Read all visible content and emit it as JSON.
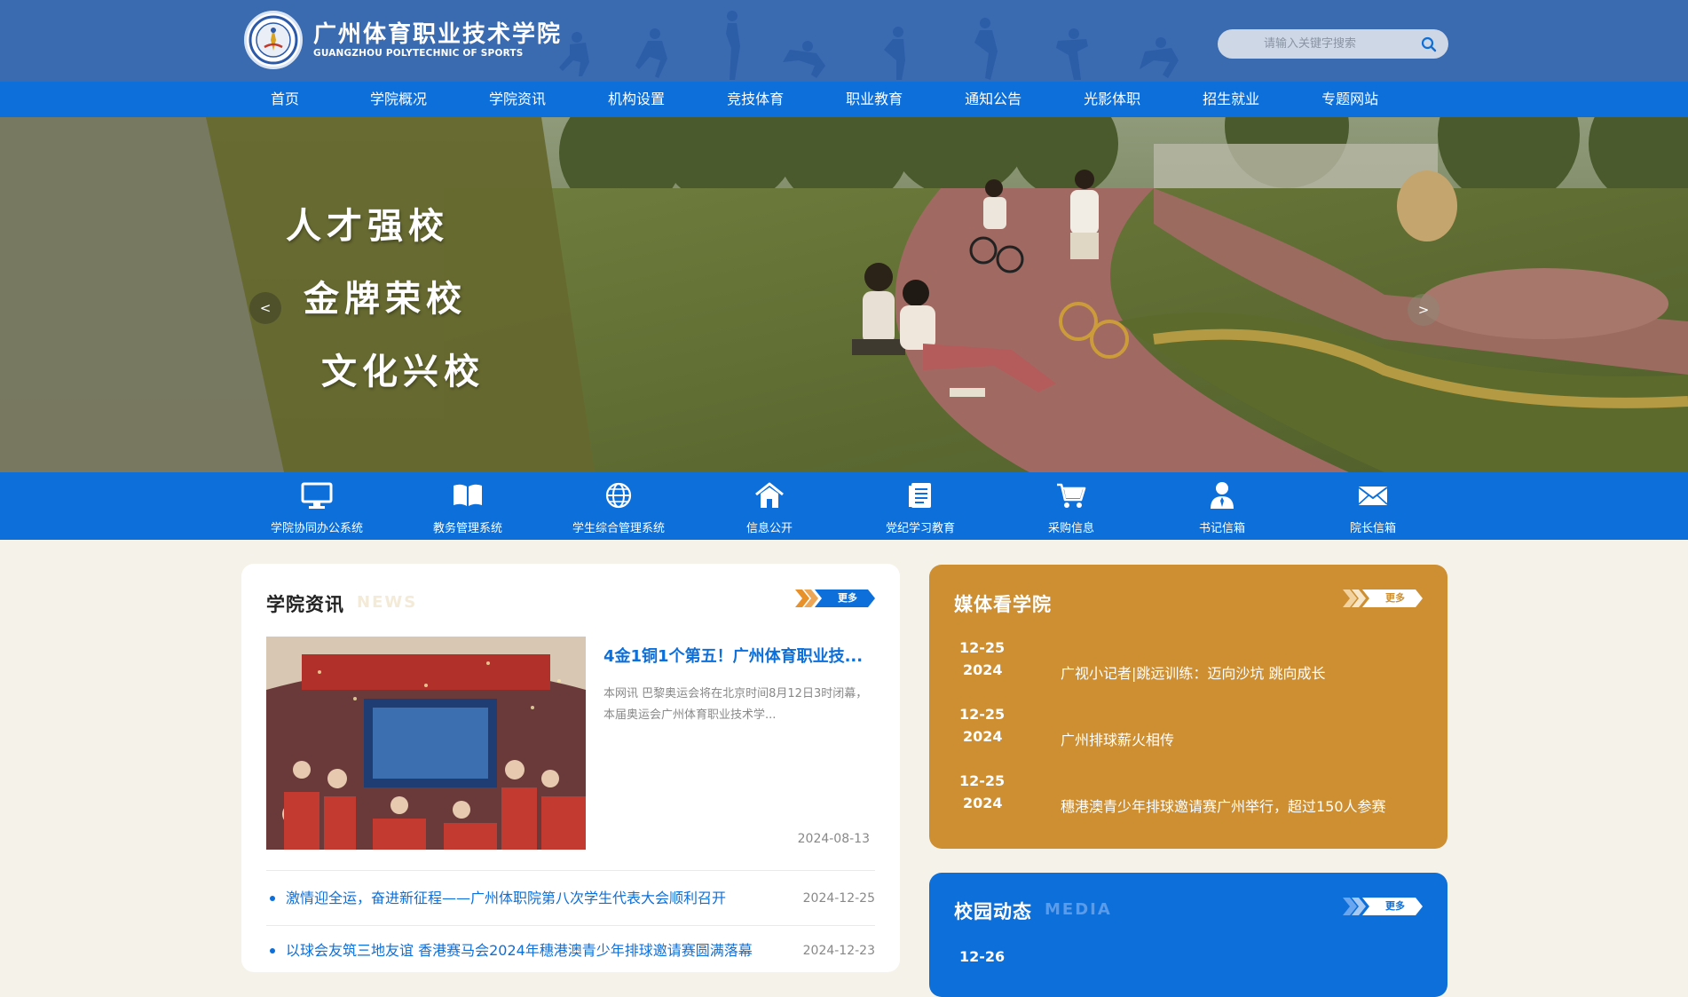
{
  "header": {
    "logo_cn": "广州体育职业技术学院",
    "logo_en": "GUANGZHOU POLYTECHNIC OF SPORTS",
    "search_placeholder": "请输入关键字搜索",
    "icons": {
      "search": "search-icon",
      "logo": "college-seal-logo"
    }
  },
  "nav": {
    "items": [
      "首页",
      "学院概况",
      "学院资讯",
      "机构设置",
      "竞技体育",
      "职业教育",
      "通知公告",
      "光影体职",
      "招生就业",
      "专题网站"
    ]
  },
  "banner": {
    "slogans": [
      "人才强校",
      "金牌荣校",
      "文化兴校"
    ],
    "prev_label": "<",
    "next_label": ">"
  },
  "quick_links": [
    {
      "label": "学院协同办公系统",
      "icon": "monitor-icon"
    },
    {
      "label": "教务管理系统",
      "icon": "open-book-icon"
    },
    {
      "label": "学生综合管理系统",
      "icon": "globe-icon"
    },
    {
      "label": "信息公开",
      "icon": "home-icon"
    },
    {
      "label": "党纪学习教育",
      "icon": "document-icon"
    },
    {
      "label": "采购信息",
      "icon": "cart-icon"
    },
    {
      "label": "书记信箱",
      "icon": "person-icon"
    },
    {
      "label": "院长信箱",
      "icon": "mail-icon"
    }
  ],
  "news": {
    "title": "学院资讯",
    "subtitle": "NEWS",
    "more": "更多",
    "featured": {
      "title": "4金1铜1个第五！广州体育职业技...",
      "summary": "本网讯 巴黎奥运会将在北京时间8月12日3时闭幕，本届奥运会广州体育职业技术学...",
      "date": "2024-08-13"
    },
    "items": [
      {
        "title": "激情迎全运，奋进新征程——广州体职院第八次学生代表大会顺利召开",
        "date": "2024-12-25"
      },
      {
        "title": "以球会友筑三地友谊 香港赛马会2024年穗港澳青少年排球邀请赛圆满落幕",
        "date": "2024-12-23"
      }
    ]
  },
  "media": {
    "title": "媒体看学院",
    "more": "更多",
    "items": [
      {
        "date": "12-25",
        "year": "2024",
        "title": "广视小记者|跳远训练：迈向沙坑 跳向成长"
      },
      {
        "date": "12-25",
        "year": "2024",
        "title": "广州排球薪火相传"
      },
      {
        "date": "12-25",
        "year": "2024",
        "title": "穗港澳青少年排球邀请赛广州举行，超过150人参赛"
      }
    ]
  },
  "campus": {
    "title": "校园动态",
    "subtitle": "MEDIA",
    "more": "更多",
    "first_date": "12-26"
  },
  "colors": {
    "header_bg": "#3a6ab0",
    "nav_bg": "#0d6fd9",
    "media_bg": "#cd8f32",
    "page_bg": "#f5f2e9",
    "accent_orange": "#e8902a"
  }
}
